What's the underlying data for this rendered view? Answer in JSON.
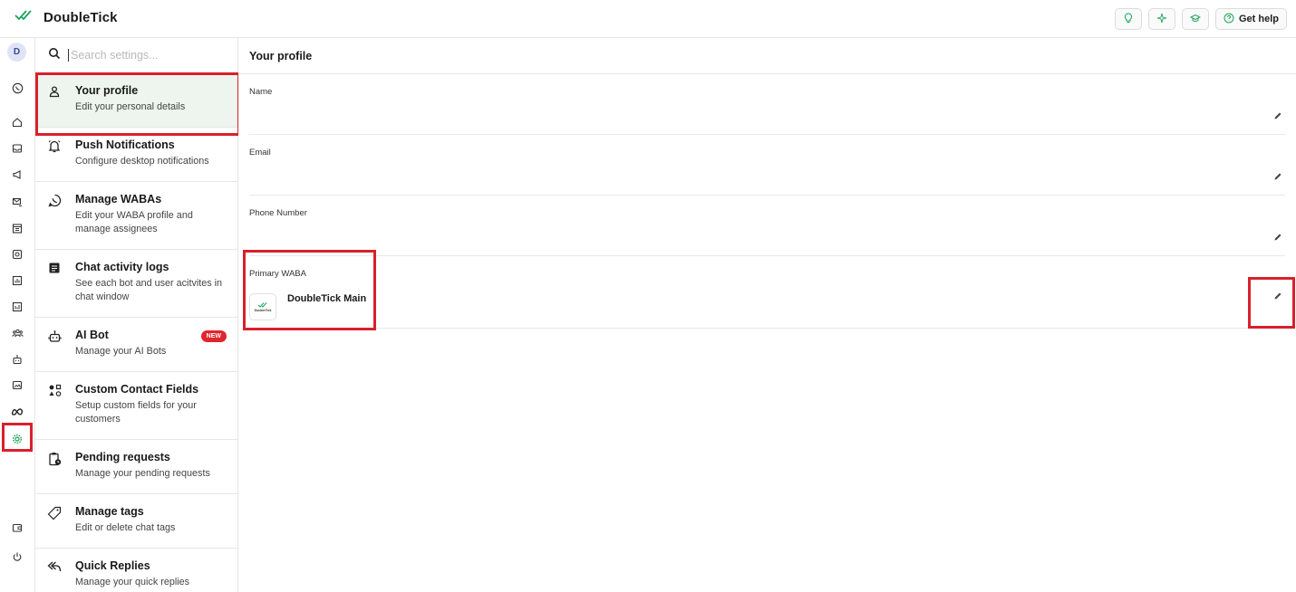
{
  "app": {
    "name": "DoubleTick"
  },
  "header": {
    "actions": [
      {
        "icon": "lightbulb-icon",
        "label": ""
      },
      {
        "icon": "sparkle-icon",
        "label": ""
      },
      {
        "icon": "graduation-cap-icon",
        "label": ""
      },
      {
        "icon": "help-circle-icon",
        "label": "Get help"
      }
    ]
  },
  "rail": {
    "avatar_initial": "D",
    "items": [
      "whatsapp-icon",
      "home-icon",
      "inbox-icon",
      "megaphone-icon",
      "mail-send-icon",
      "calendar-icon",
      "target-icon",
      "chart-icon",
      "report-icon",
      "team-icon",
      "bot-icon",
      "chat-image-icon",
      "meta-icon",
      "settings-icon",
      "wallet-icon",
      "power-icon"
    ]
  },
  "search": {
    "placeholder": "Search settings..."
  },
  "settings_nav": [
    {
      "title": "Your profile",
      "sub": "Edit your personal details",
      "icon": "user-icon",
      "active": true
    },
    {
      "title": "Push Notifications",
      "sub": "Configure desktop notifications",
      "icon": "bell-icon"
    },
    {
      "title": "Manage WABAs",
      "sub": "Edit your WABA profile and manage assignees",
      "icon": "whatsapp-icon"
    },
    {
      "title": "Chat activity logs",
      "sub": "See each bot and user acitvites in chat window",
      "icon": "document-icon"
    },
    {
      "title": "AI Bot",
      "sub": "Manage your AI Bots",
      "icon": "robot-icon",
      "badge": "NEW"
    },
    {
      "title": "Custom Contact Fields",
      "sub": "Setup custom fields for your customers",
      "icon": "shapes-icon"
    },
    {
      "title": "Pending requests",
      "sub": "Manage your pending requests",
      "icon": "clipboard-clock-icon"
    },
    {
      "title": "Manage tags",
      "sub": "Edit or delete chat tags",
      "icon": "tag-icon"
    },
    {
      "title": "Quick Replies",
      "sub": "Manage your quick replies",
      "icon": "reply-icon"
    }
  ],
  "profile": {
    "title": "Your profile",
    "fields": [
      {
        "label": "Name",
        "value": ""
      },
      {
        "label": "Email",
        "value": ""
      },
      {
        "label": "Phone Number",
        "value": ""
      }
    ],
    "primary_waba": {
      "label": "Primary WABA",
      "name": "DoubleTick Main",
      "logo_text": "DoubleTick"
    }
  },
  "colors": {
    "accent": "#1aa35a",
    "highlight": "#d9202c",
    "active_bg": "#eef5ee"
  }
}
